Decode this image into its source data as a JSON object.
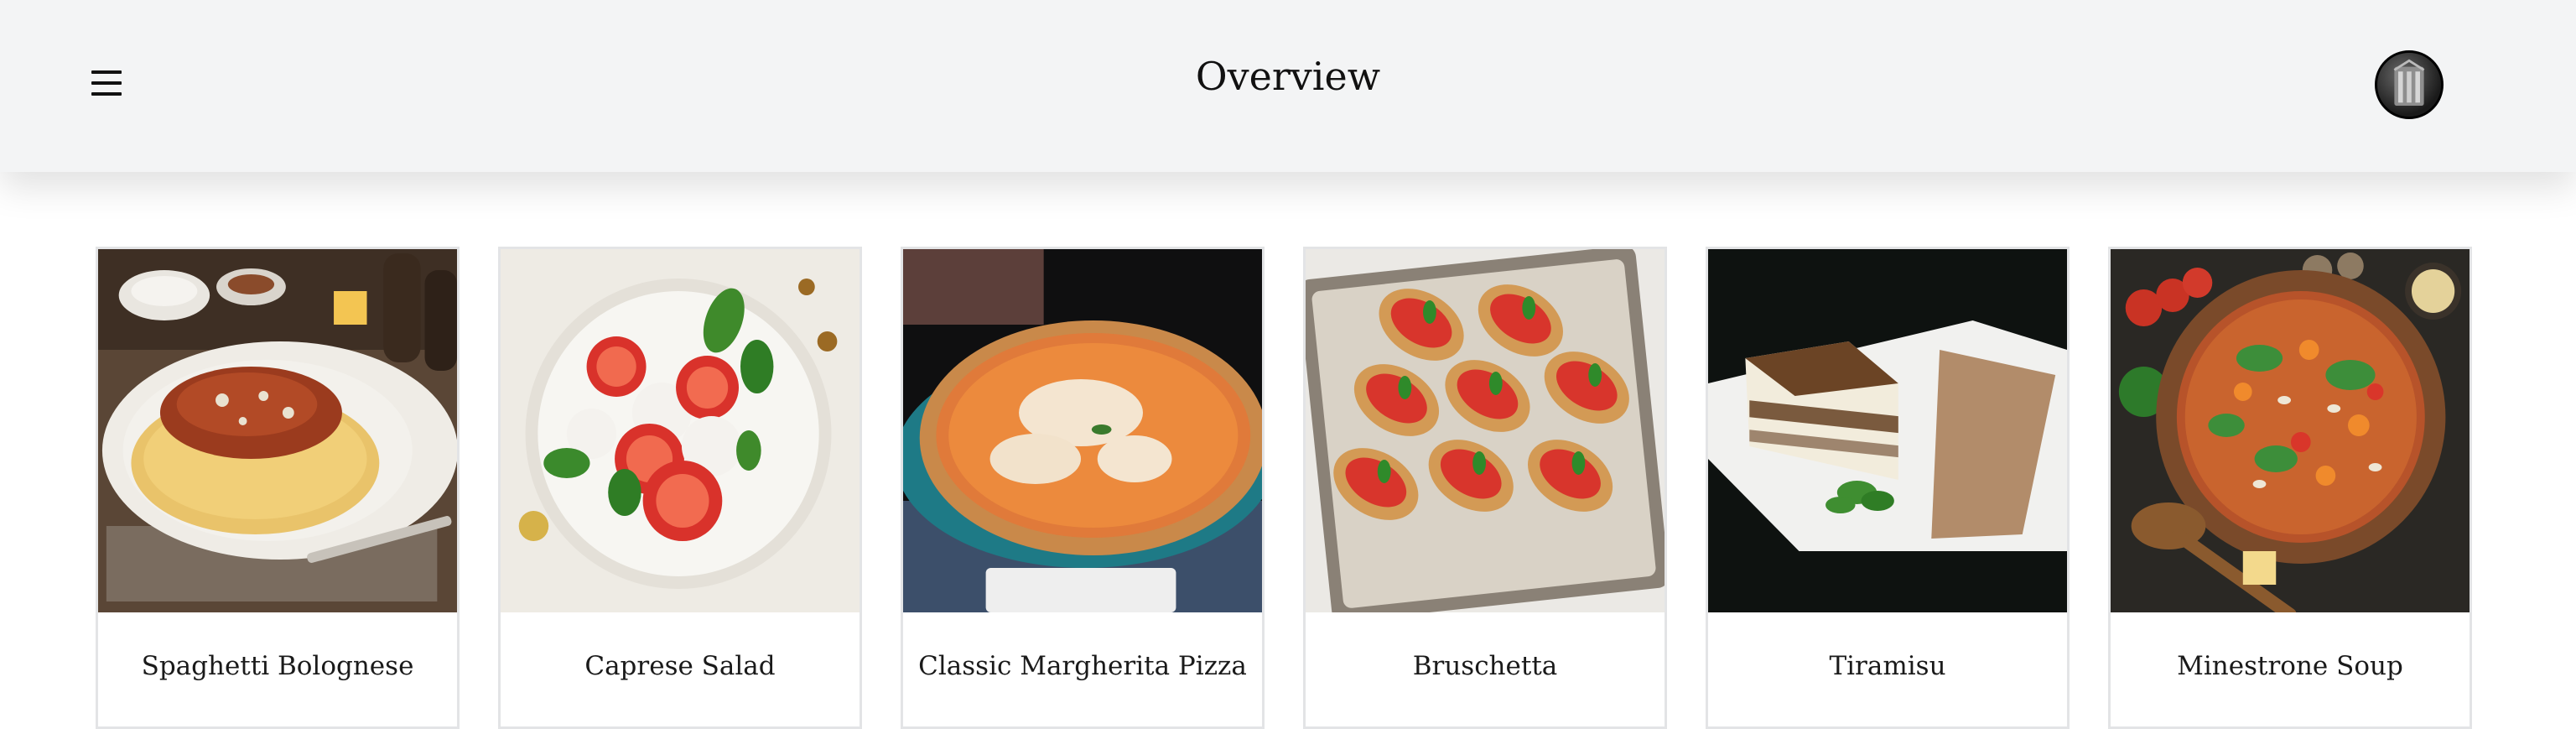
{
  "header": {
    "title": "Overview",
    "menu_icon": "hamburger-menu-icon",
    "avatar_icon": "user-avatar"
  },
  "recipes": [
    {
      "name": "Spaghetti Bolognese",
      "image": "spaghetti-bolognese-photo"
    },
    {
      "name": "Caprese Salad",
      "image": "caprese-salad-photo"
    },
    {
      "name": "Classic Margherita Pizza",
      "image": "margherita-pizza-photo"
    },
    {
      "name": "Bruschetta",
      "image": "bruschetta-photo"
    },
    {
      "name": "Tiramisu",
      "image": "tiramisu-photo"
    },
    {
      "name": "Minestrone Soup",
      "image": "minestrone-soup-photo"
    }
  ]
}
